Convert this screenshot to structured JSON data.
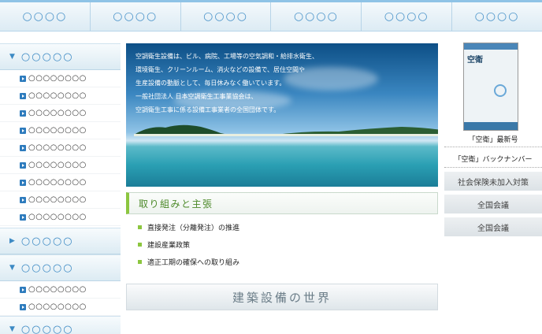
{
  "topnav": {
    "items": [
      "○○○○",
      "○○○○",
      "○○○○",
      "○○○○",
      "○○○○",
      "○○○○"
    ]
  },
  "leftmenu": {
    "sections": [
      {
        "label": "○○○○○",
        "expanded": true,
        "items": [
          "○○○○○○○○",
          "○○○○○○○○",
          "○○○○○○○○",
          "○○○○○○○○",
          "○○○○○○○○",
          "○○○○○○○○",
          "○○○○○○○○",
          "○○○○○○○○",
          "○○○○○○○○"
        ]
      },
      {
        "label": "○○○○○",
        "expanded": false,
        "items": []
      },
      {
        "label": "○○○○○",
        "expanded": true,
        "items": [
          "○○○○○○○○",
          "○○○○○○○○"
        ]
      },
      {
        "label": "○○○○○",
        "expanded": true,
        "items": []
      }
    ]
  },
  "hero": {
    "lines": [
      "空調衛生設備は、ビル、病院、工場等の空気調和・給排水衛生、",
      "環境衛生、クリーンルーム、消火などの設備で、居住空間や",
      "生産設備の動脈として、毎日休みなく働いています。",
      "一般社団法人 日本空調衛生工事業協会は、",
      "空調衛生工事に係る設備工事業者の全国団体です。"
    ]
  },
  "policy": {
    "title": "取り組みと主張",
    "links": [
      "直接発注（分離発注）の推進",
      "建設産業政策",
      "適正工期の確保への取り組み"
    ]
  },
  "banner": {
    "label": "建築設備の世界"
  },
  "right": {
    "magazine_title": "空衛",
    "latest_caption": "「空衛」最新号",
    "backnumber_caption": "「空衛」バックナンバー",
    "buttons": [
      "社会保険未加入対策",
      "全国会議",
      "全国会議"
    ]
  },
  "colors": {
    "accent": "#3d8ac4",
    "green": "#8cc63f",
    "bullet": "#2d7bbd"
  }
}
